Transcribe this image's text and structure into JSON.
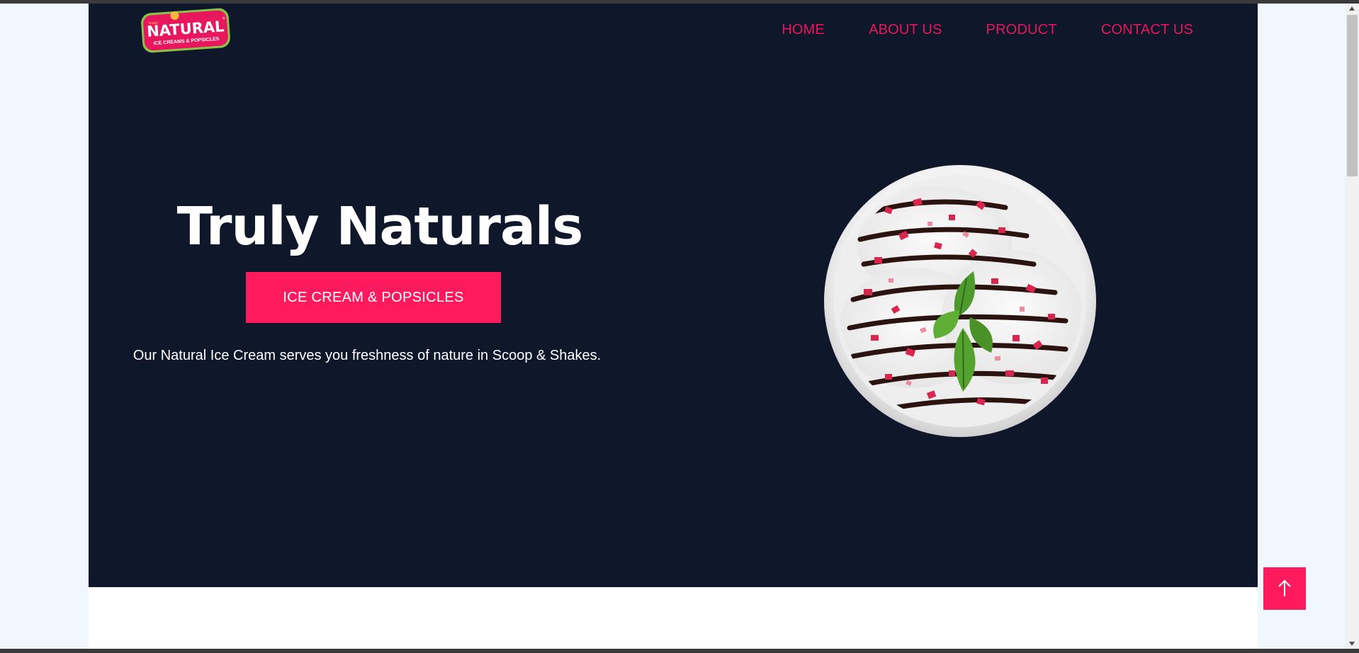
{
  "brand": {
    "logo_small_text": "Fresh",
    "logo_main_text": "NATURAL",
    "logo_tagline": "ICE CREAMS & POPSICLES",
    "logo_mark": "®"
  },
  "nav": {
    "items": [
      {
        "label": "HOME"
      },
      {
        "label": "ABOUT US"
      },
      {
        "label": "PRODUCT"
      },
      {
        "label": "CONTACT US"
      }
    ]
  },
  "hero": {
    "title": "Truly Naturals",
    "cta_label": "ICE CREAM & POPSICLES",
    "description": "Our Natural Ice Cream serves you freshness of nature in Scoop & Shakes.",
    "image_icon": "ice-cream-bowl-image"
  },
  "back_to_top": {
    "icon": "arrow-up-icon"
  },
  "colors": {
    "accent": "#ff1a5e",
    "nav_link": "#e8175d",
    "hero_bg": "#0f172a",
    "page_bg": "#f0f7ff",
    "logo_green": "#8bc34a"
  }
}
